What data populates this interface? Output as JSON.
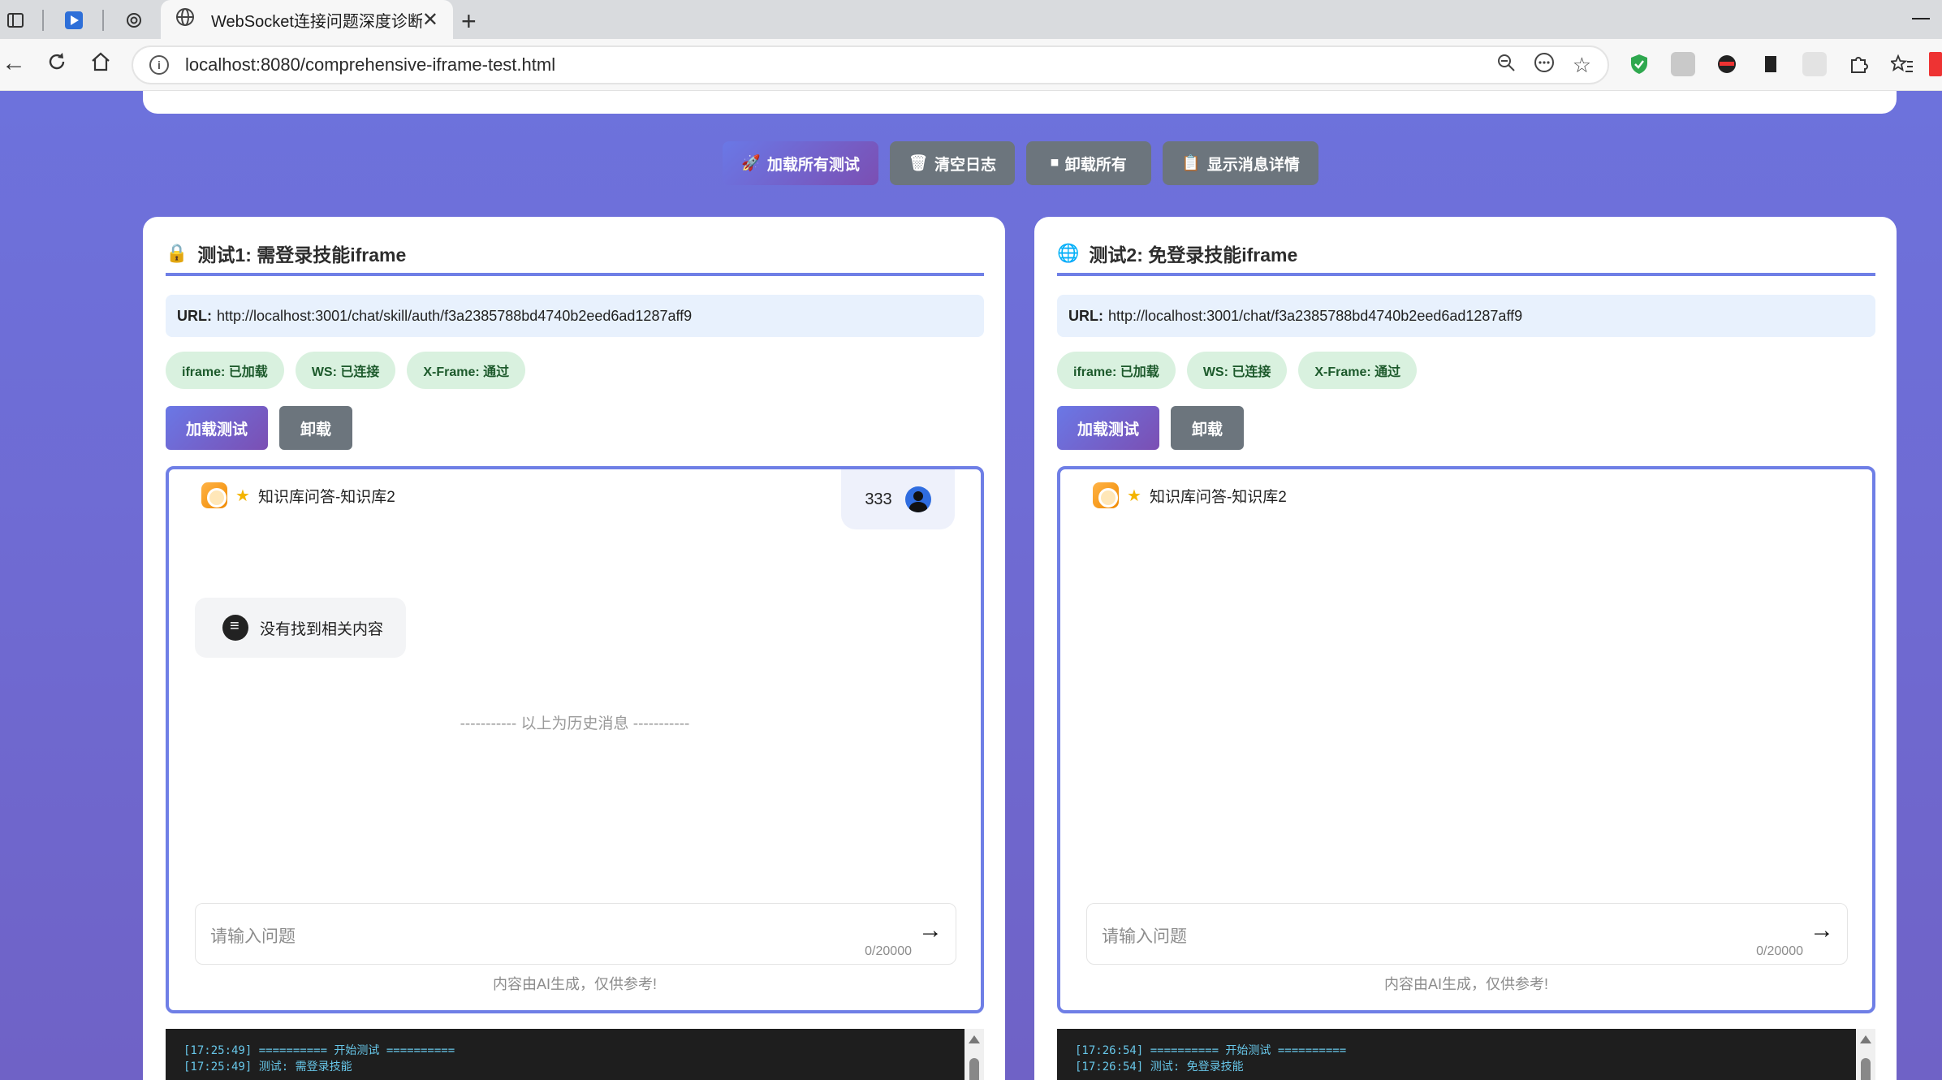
{
  "browser": {
    "tab_title": "WebSocket连接问题深度诊断",
    "url": "localhost:8080/comprehensive-iframe-test.html"
  },
  "toolbar": {
    "load_all": "加载所有测试",
    "clear_log": "清空日志",
    "unload_all": "卸载所有",
    "show_details": "显示消息详情"
  },
  "panels": [
    {
      "icon": "lock-icon",
      "title": "测试1: 需登录技能iframe",
      "url_label": "URL:",
      "url": "http://localhost:3001/chat/skill/auth/f3a2385788bd4740b2eed6ad1287aff9",
      "badges": [
        "iframe: 已加载",
        "WS: 已连接",
        "X-Frame: 通过"
      ],
      "load_btn": "加载测试",
      "unload_btn": "卸载",
      "chat_title": "知识库问答-知识库2",
      "user_name": "333",
      "bot_msg": "没有找到相关内容",
      "history": "----------- 以上为历史消息 -----------",
      "input_placeholder": "请输入问题",
      "counter": "0/20000",
      "disclaimer": "内容由AI生成，仅供参考!",
      "log_lines": [
        "[17:25:49] ========== 开始测试 ==========",
        "[17:25:49] 测试: 需登录技能"
      ]
    },
    {
      "icon": "globe-icon",
      "title": "测试2: 免登录技能iframe",
      "url_label": "URL:",
      "url": "http://localhost:3001/chat/f3a2385788bd4740b2eed6ad1287aff9",
      "badges": [
        "iframe: 已加载",
        "WS: 已连接",
        "X-Frame: 通过"
      ],
      "load_btn": "加载测试",
      "unload_btn": "卸载",
      "chat_title": "知识库问答-知识库2",
      "input_placeholder": "请输入问题",
      "counter": "0/20000",
      "disclaimer": "内容由AI生成，仅供参考!",
      "log_lines": [
        "[17:26:54] ========== 开始测试 ==========",
        "[17:26:54] 测试: 免登录技能"
      ]
    }
  ],
  "colors": {
    "accent": "#6f7fe6",
    "badge_bg": "#d9f1df",
    "badge_text": "#1d5a2c",
    "button_gray": "#6c757d"
  }
}
